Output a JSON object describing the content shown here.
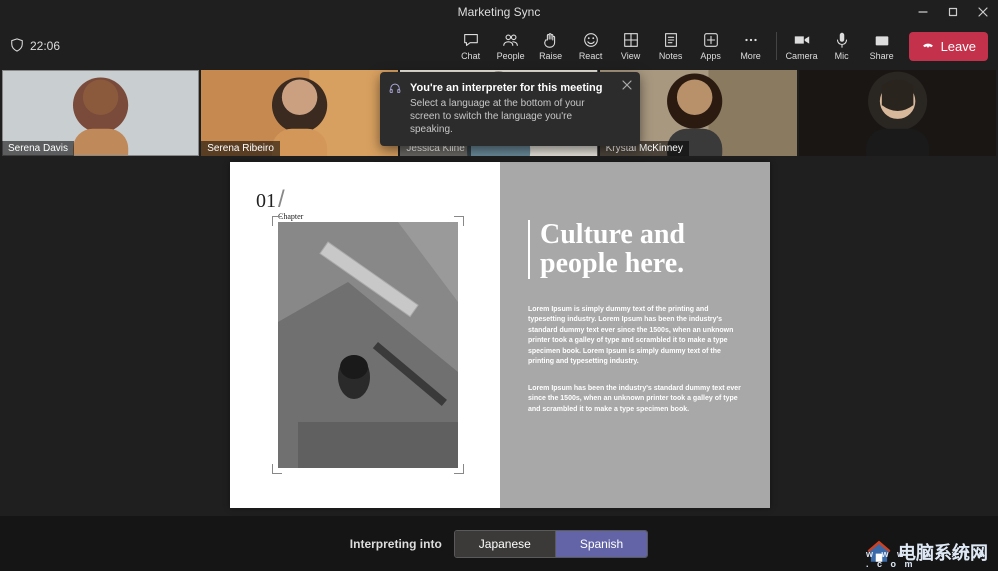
{
  "window": {
    "title": "Marketing Sync"
  },
  "timer": {
    "value": "22:06"
  },
  "toolbar": {
    "chat": "Chat",
    "people": "People",
    "raise": "Raise",
    "react": "React",
    "view": "View",
    "notes": "Notes",
    "apps": "Apps",
    "more": "More",
    "camera": "Camera",
    "mic": "Mic",
    "share": "Share",
    "leave": "Leave"
  },
  "participants": [
    {
      "name": "Serena Davis"
    },
    {
      "name": "Serena Ribeiro"
    },
    {
      "name": "Jessica Kline"
    },
    {
      "name": "Krystal McKinney"
    },
    {
      "name": ""
    }
  ],
  "toast": {
    "title": "You're an interpreter for this meeting",
    "body": "Select a language at the bottom of your screen to switch the language you're speaking."
  },
  "slide": {
    "chapter_number": "01",
    "chapter_label": "Chapter",
    "headline": "Culture and people here.",
    "para1": "Lorem Ipsum is simply dummy text of the printing and typesetting industry. Lorem Ipsum has been the industry's standard dummy text ever since the 1500s, when an unknown printer took a galley of type and scrambled it to make a type specimen book. Lorem Ipsum is simply dummy text of the printing and typesetting industry.",
    "para2": "Lorem Ipsum has been the industry's standard dummy text ever since the 1500s, when an unknown printer took a galley of type and scrambled it to make a type specimen book."
  },
  "interpreter": {
    "label": "Interpreting into",
    "options": [
      "Japanese",
      "Spanish"
    ],
    "active": "Spanish"
  },
  "watermark": {
    "text": "电脑系统网",
    "url": "w w w . d n x t w . c o m"
  }
}
